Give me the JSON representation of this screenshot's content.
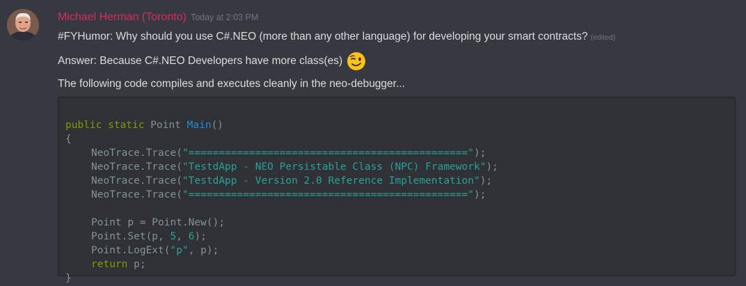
{
  "message": {
    "author": "Michael Herman (Toronto)",
    "timestamp": "Today at 2:03 PM",
    "author_color": "#d72d5c",
    "line1": "#FYHumor: Why should you use C#.NEO (more than any other language) for developing your smart contracts?",
    "edited_label": "(edited)",
    "line2": "Answer: Because C#.NEO Developers have more class(es)",
    "emoji": "winking-face-emoji",
    "line3": "The following code compiles and executes cleanly in the neo-debugger..."
  },
  "code": {
    "l1": {
      "kw1": "public",
      "kw2": "static",
      "type": "Point",
      "fn": "Main",
      "rest": "()"
    },
    "l2": "{",
    "trace_prefix": "NeoTrace.Trace(",
    "trace_suffix": ");",
    "trace_strings": [
      "\"==============================================\"",
      "\"TestdApp - NEO Persistable Class (NPC) Framework\"",
      "\"TestdApp - Version 2.0 Reference Implementation\"",
      "\"==============================================\""
    ],
    "l8": "Point p = Point.New();",
    "l9": {
      "pre": "Point.Set(p, ",
      "n1": "5",
      "mid": ", ",
      "n2": "6",
      "post": ");"
    },
    "l10": {
      "pre": "Point.LogExt(",
      "str": "\"p\"",
      "post": ", p);"
    },
    "l11": {
      "kw": "return",
      "rest": " p;"
    },
    "l12": "}"
  }
}
